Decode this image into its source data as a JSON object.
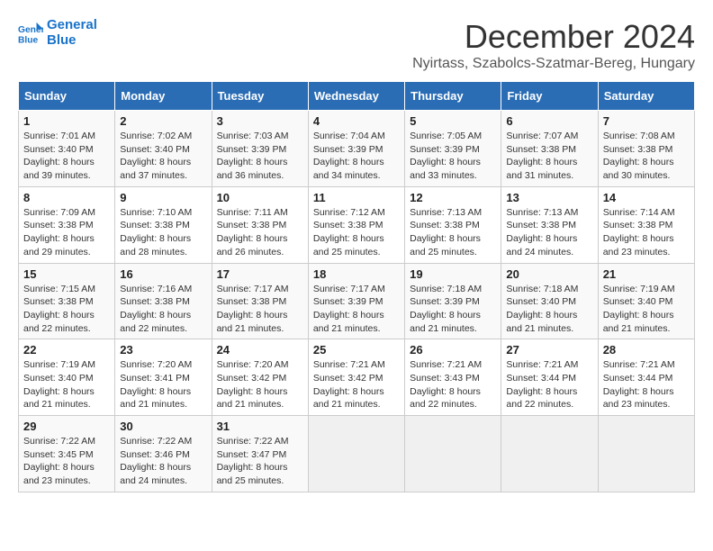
{
  "logo": {
    "line1": "General",
    "line2": "Blue"
  },
  "title": "December 2024",
  "location": "Nyirtass, Szabolcs-Szatmar-Bereg, Hungary",
  "days_of_week": [
    "Sunday",
    "Monday",
    "Tuesday",
    "Wednesday",
    "Thursday",
    "Friday",
    "Saturday"
  ],
  "weeks": [
    [
      {
        "day": "1",
        "sunrise": "7:01 AM",
        "sunset": "3:40 PM",
        "daylight": "8 hours and 39 minutes."
      },
      {
        "day": "2",
        "sunrise": "7:02 AM",
        "sunset": "3:40 PM",
        "daylight": "8 hours and 37 minutes."
      },
      {
        "day": "3",
        "sunrise": "7:03 AM",
        "sunset": "3:39 PM",
        "daylight": "8 hours and 36 minutes."
      },
      {
        "day": "4",
        "sunrise": "7:04 AM",
        "sunset": "3:39 PM",
        "daylight": "8 hours and 34 minutes."
      },
      {
        "day": "5",
        "sunrise": "7:05 AM",
        "sunset": "3:39 PM",
        "daylight": "8 hours and 33 minutes."
      },
      {
        "day": "6",
        "sunrise": "7:07 AM",
        "sunset": "3:38 PM",
        "daylight": "8 hours and 31 minutes."
      },
      {
        "day": "7",
        "sunrise": "7:08 AM",
        "sunset": "3:38 PM",
        "daylight": "8 hours and 30 minutes."
      }
    ],
    [
      {
        "day": "8",
        "sunrise": "7:09 AM",
        "sunset": "3:38 PM",
        "daylight": "8 hours and 29 minutes."
      },
      {
        "day": "9",
        "sunrise": "7:10 AM",
        "sunset": "3:38 PM",
        "daylight": "8 hours and 28 minutes."
      },
      {
        "day": "10",
        "sunrise": "7:11 AM",
        "sunset": "3:38 PM",
        "daylight": "8 hours and 26 minutes."
      },
      {
        "day": "11",
        "sunrise": "7:12 AM",
        "sunset": "3:38 PM",
        "daylight": "8 hours and 25 minutes."
      },
      {
        "day": "12",
        "sunrise": "7:13 AM",
        "sunset": "3:38 PM",
        "daylight": "8 hours and 25 minutes."
      },
      {
        "day": "13",
        "sunrise": "7:13 AM",
        "sunset": "3:38 PM",
        "daylight": "8 hours and 24 minutes."
      },
      {
        "day": "14",
        "sunrise": "7:14 AM",
        "sunset": "3:38 PM",
        "daylight": "8 hours and 23 minutes."
      }
    ],
    [
      {
        "day": "15",
        "sunrise": "7:15 AM",
        "sunset": "3:38 PM",
        "daylight": "8 hours and 22 minutes."
      },
      {
        "day": "16",
        "sunrise": "7:16 AM",
        "sunset": "3:38 PM",
        "daylight": "8 hours and 22 minutes."
      },
      {
        "day": "17",
        "sunrise": "7:17 AM",
        "sunset": "3:38 PM",
        "daylight": "8 hours and 21 minutes."
      },
      {
        "day": "18",
        "sunrise": "7:17 AM",
        "sunset": "3:39 PM",
        "daylight": "8 hours and 21 minutes."
      },
      {
        "day": "19",
        "sunrise": "7:18 AM",
        "sunset": "3:39 PM",
        "daylight": "8 hours and 21 minutes."
      },
      {
        "day": "20",
        "sunrise": "7:18 AM",
        "sunset": "3:40 PM",
        "daylight": "8 hours and 21 minutes."
      },
      {
        "day": "21",
        "sunrise": "7:19 AM",
        "sunset": "3:40 PM",
        "daylight": "8 hours and 21 minutes."
      }
    ],
    [
      {
        "day": "22",
        "sunrise": "7:19 AM",
        "sunset": "3:40 PM",
        "daylight": "8 hours and 21 minutes."
      },
      {
        "day": "23",
        "sunrise": "7:20 AM",
        "sunset": "3:41 PM",
        "daylight": "8 hours and 21 minutes."
      },
      {
        "day": "24",
        "sunrise": "7:20 AM",
        "sunset": "3:42 PM",
        "daylight": "8 hours and 21 minutes."
      },
      {
        "day": "25",
        "sunrise": "7:21 AM",
        "sunset": "3:42 PM",
        "daylight": "8 hours and 21 minutes."
      },
      {
        "day": "26",
        "sunrise": "7:21 AM",
        "sunset": "3:43 PM",
        "daylight": "8 hours and 22 minutes."
      },
      {
        "day": "27",
        "sunrise": "7:21 AM",
        "sunset": "3:44 PM",
        "daylight": "8 hours and 22 minutes."
      },
      {
        "day": "28",
        "sunrise": "7:21 AM",
        "sunset": "3:44 PM",
        "daylight": "8 hours and 23 minutes."
      }
    ],
    [
      {
        "day": "29",
        "sunrise": "7:22 AM",
        "sunset": "3:45 PM",
        "daylight": "8 hours and 23 minutes."
      },
      {
        "day": "30",
        "sunrise": "7:22 AM",
        "sunset": "3:46 PM",
        "daylight": "8 hours and 24 minutes."
      },
      {
        "day": "31",
        "sunrise": "7:22 AM",
        "sunset": "3:47 PM",
        "daylight": "8 hours and 25 minutes."
      },
      null,
      null,
      null,
      null
    ]
  ]
}
